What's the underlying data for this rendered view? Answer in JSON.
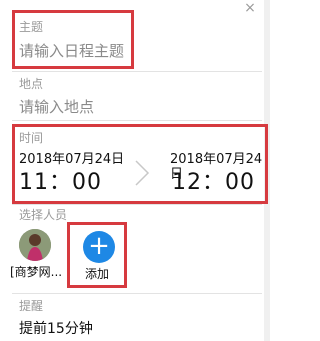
{
  "window": {
    "close_glyph": "×"
  },
  "subject": {
    "label": "主题",
    "placeholder": "请输入日程主题"
  },
  "location": {
    "label": "地点",
    "placeholder": "请输入地点"
  },
  "time": {
    "label": "时间",
    "start_date": "2018年07月24日",
    "start_time": "11：00",
    "end_date": "2018年07月24日",
    "end_time": "12：00"
  },
  "participants": {
    "label": "选择人员",
    "members": [
      {
        "name": "[商梦网..."
      }
    ],
    "add_label": "添加",
    "add_icon": "plus-icon"
  },
  "reminder": {
    "label": "提醒",
    "value": "提前15分钟"
  },
  "colors": {
    "accent": "#1e88e5",
    "highlight": "#d63a3f"
  }
}
